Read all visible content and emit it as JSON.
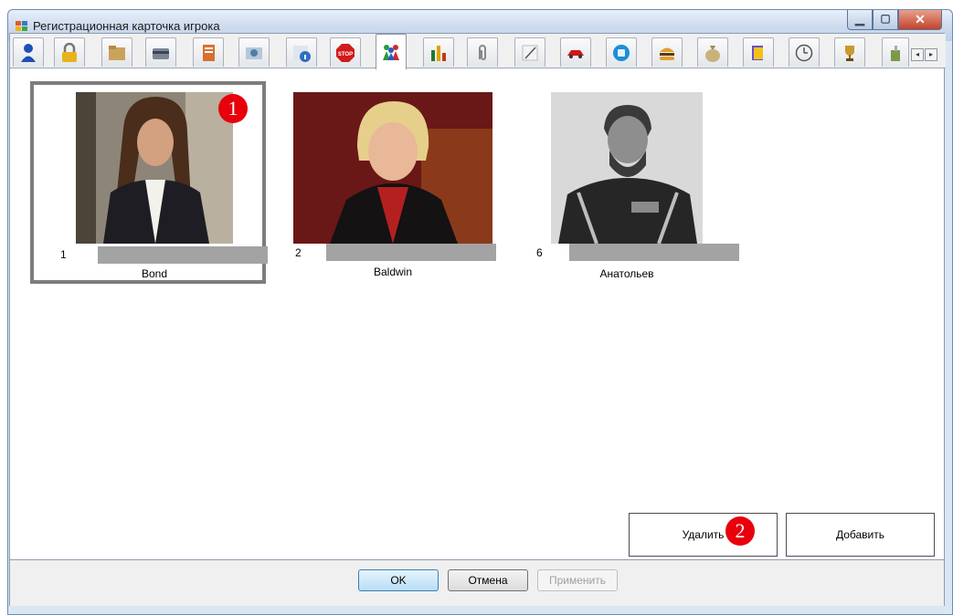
{
  "window": {
    "title": "Регистрационная карточка игрока"
  },
  "tabs": [
    {
      "icon": "user-icon"
    },
    {
      "icon": "lock-icon"
    },
    {
      "icon": "folder-icon"
    },
    {
      "icon": "card-icon"
    },
    {
      "icon": "notebook-icon"
    },
    {
      "icon": "camera-icon"
    },
    {
      "icon": "info-icon"
    },
    {
      "icon": "stop-sign-icon"
    },
    {
      "icon": "group-icon",
      "active": true
    },
    {
      "icon": "bar-chart-icon"
    },
    {
      "icon": "paperclip-icon"
    },
    {
      "icon": "pen-icon"
    },
    {
      "icon": "car-icon"
    },
    {
      "icon": "globe-icon"
    },
    {
      "icon": "burger-icon"
    },
    {
      "icon": "money-bag-icon"
    },
    {
      "icon": "book-icon"
    },
    {
      "icon": "clock-money-icon"
    },
    {
      "icon": "trophy-icon"
    },
    {
      "icon": "paint-icon"
    }
  ],
  "players": [
    {
      "number": "1",
      "name": "Bond",
      "selected": true
    },
    {
      "number": "2",
      "name": "Baldwin",
      "selected": false
    },
    {
      "number": "6",
      "name": "Анатольев",
      "selected": false
    }
  ],
  "markers": [
    "1",
    "2"
  ],
  "actions": {
    "delete_label": "Удалить",
    "add_label": "Добавить"
  },
  "dialog": {
    "ok_label": "OK",
    "cancel_label": "Отмена",
    "apply_label": "Применить"
  },
  "colors": {
    "marker": "#e8000c",
    "selection_frame": "#7d7d7d",
    "name_bar": "#a3a3a3"
  }
}
